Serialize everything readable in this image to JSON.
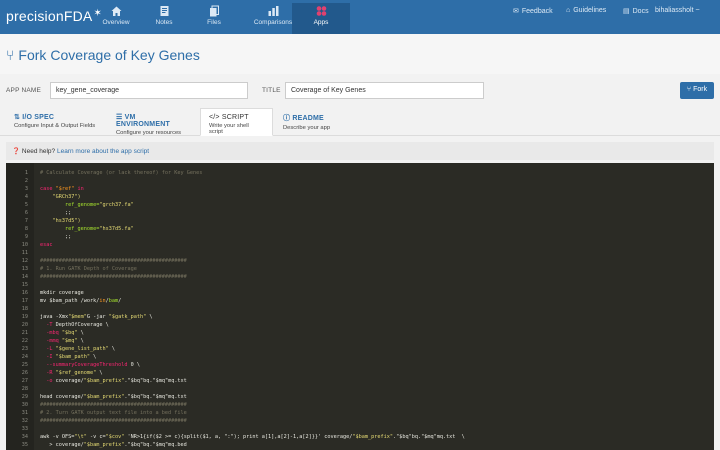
{
  "brand": "precisionFDA",
  "nav": [
    {
      "label": "Overview",
      "icon": "home-icon"
    },
    {
      "label": "Notes",
      "icon": "note-icon"
    },
    {
      "label": "Files",
      "icon": "files-icon"
    },
    {
      "label": "Comparisons",
      "icon": "chart-icon"
    },
    {
      "label": "Apps",
      "icon": "apps-icon"
    }
  ],
  "active_nav": "Apps",
  "right_links": {
    "feedback": "Feedback",
    "guidelines": "Guidelines",
    "docs": "Docs",
    "user": "bihaliassholt ~"
  },
  "page": {
    "title_prefix": "Fork",
    "title": "Coverage of Key Genes"
  },
  "form": {
    "app_name_label": "APP NAME",
    "app_name_value": "key_gene_coverage",
    "title_label": "TITLE",
    "title_value": "Coverage of Key Genes",
    "fork_button": "Fork"
  },
  "tabs": [
    {
      "label": "I/O SPEC",
      "sub": "Configure Input & Output Fields",
      "icon": "io-icon"
    },
    {
      "label": "VM ENVIRONMENT",
      "sub": "Configure your resources",
      "icon": "server-icon"
    },
    {
      "label": "SCRIPT",
      "sub": "Write your shell script",
      "icon": "code-icon"
    },
    {
      "label": "README",
      "sub": "Describe your app",
      "icon": "info-icon"
    }
  ],
  "active_tab": "SCRIPT",
  "help": {
    "prefix": "Need help?",
    "link": "Learn more about the app script"
  },
  "code_lines": [
    {
      "n": "1",
      "parts": [
        [
          "cm",
          "# Calculate Coverage (or lack thereof) for Key Genes"
        ]
      ]
    },
    {
      "n": "2",
      "parts": [
        [
          "",
          ""
        ]
      ]
    },
    {
      "n": "3",
      "parts": [
        [
          "kw",
          "case "
        ],
        [
          "vr",
          "\"$ref\""
        ],
        [
          "kw",
          " in"
        ]
      ]
    },
    {
      "n": "4",
      "parts": [
        [
          "st",
          "    \"GRCh37\")"
        ]
      ]
    },
    {
      "n": "5",
      "parts": [
        [
          "fn",
          "        ref_genome="
        ],
        [
          "st",
          "\"grch37.fa\""
        ]
      ]
    },
    {
      "n": "6",
      "parts": [
        [
          "",
          "        ;;"
        ]
      ]
    },
    {
      "n": "7",
      "parts": [
        [
          "st",
          "    \"hs37d5\")"
        ]
      ]
    },
    {
      "n": "8",
      "parts": [
        [
          "fn",
          "        ref_genome="
        ],
        [
          "st",
          "\"hs37d5.fa\""
        ]
      ]
    },
    {
      "n": "9",
      "parts": [
        [
          "",
          "        ;;"
        ]
      ]
    },
    {
      "n": "10",
      "parts": [
        [
          "kw",
          "esac"
        ]
      ]
    },
    {
      "n": "11",
      "parts": [
        [
          "",
          ""
        ]
      ]
    },
    {
      "n": "12",
      "parts": [
        [
          "cm",
          "###############################################"
        ]
      ]
    },
    {
      "n": "13",
      "parts": [
        [
          "cm",
          "# 1. Run GATK Depth of Coverage"
        ]
      ]
    },
    {
      "n": "14",
      "parts": [
        [
          "cm",
          "###############################################"
        ]
      ]
    },
    {
      "n": "15",
      "parts": [
        [
          "",
          ""
        ]
      ]
    },
    {
      "n": "16",
      "parts": [
        [
          "",
          "mkdir coverage"
        ]
      ]
    },
    {
      "n": "17",
      "parts": [
        [
          "",
          "mv $bam_path /work/"
        ],
        [
          "vr",
          "in"
        ],
        [
          "",
          "/"
        ],
        [
          "fn",
          "bam"
        ],
        [
          "",
          "/"
        ]
      ]
    },
    {
      "n": "18",
      "parts": [
        [
          "",
          ""
        ]
      ]
    },
    {
      "n": "19",
      "parts": [
        [
          "",
          "java -Xmx"
        ],
        [
          "st",
          "\"$mem\""
        ],
        [
          "",
          "G -jar "
        ],
        [
          "st",
          "\"$gatk_path\""
        ],
        [
          "",
          " \\"
        ]
      ]
    },
    {
      "n": "20",
      "parts": [
        [
          "kw",
          "  -T"
        ],
        [
          "",
          " DepthOfCoverage \\"
        ]
      ]
    },
    {
      "n": "21",
      "parts": [
        [
          "kw",
          "  -mbq"
        ],
        [
          "st",
          " \"$bq\""
        ],
        [
          "",
          " \\"
        ]
      ]
    },
    {
      "n": "22",
      "parts": [
        [
          "kw",
          "  -mmq"
        ],
        [
          "st",
          " \"$mq\""
        ],
        [
          "",
          " \\"
        ]
      ]
    },
    {
      "n": "23",
      "parts": [
        [
          "kw",
          "  -L"
        ],
        [
          "st",
          " \"$gene_list_path\""
        ],
        [
          "",
          " \\"
        ]
      ]
    },
    {
      "n": "24",
      "parts": [
        [
          "kw",
          "  -I"
        ],
        [
          "st",
          " \"$bam_path\""
        ],
        [
          "",
          " \\"
        ]
      ]
    },
    {
      "n": "25",
      "parts": [
        [
          "kw",
          "  --summaryCoverageThreshold"
        ],
        [
          "",
          " 0 \\"
        ]
      ]
    },
    {
      "n": "26",
      "parts": [
        [
          "kw",
          "  -R"
        ],
        [
          "st",
          " \"$ref_genome\""
        ],
        [
          "",
          " \\"
        ]
      ]
    },
    {
      "n": "27",
      "parts": [
        [
          "kw",
          "  -o"
        ],
        [
          "",
          " coverage/"
        ],
        [
          "st",
          "\"$bam_prefix\""
        ],
        [
          "",
          ".\"$bq\"bq.\"$mq\"mq.txt"
        ]
      ]
    },
    {
      "n": "28",
      "parts": [
        [
          "",
          ""
        ]
      ]
    },
    {
      "n": "29",
      "parts": [
        [
          "",
          "head coverage/"
        ],
        [
          "st",
          "\"$bam_prefix\""
        ],
        [
          "",
          ".\"$bq\"bq.\"$mq\"mq.txt"
        ]
      ]
    },
    {
      "n": "30",
      "parts": [
        [
          "cm",
          "###############################################"
        ]
      ]
    },
    {
      "n": "31",
      "parts": [
        [
          "cm",
          "# 2. Turn GATK output text file into a bed file"
        ]
      ]
    },
    {
      "n": "32",
      "parts": [
        [
          "cm",
          "###############################################"
        ]
      ]
    },
    {
      "n": "33",
      "parts": [
        [
          "",
          ""
        ]
      ]
    },
    {
      "n": "34",
      "parts": [
        [
          "",
          "awk -v OFS="
        ],
        [
          "st",
          "\"\\t\""
        ],
        [
          "",
          " -v c="
        ],
        [
          "st",
          "\"$cov\""
        ],
        [
          "",
          " 'NR>1{if($2 >= c){split($1, a, \":\"); print a[1],a[2]-1,a[2]}}' coverage/"
        ],
        [
          "st",
          "\"$bam_prefix\""
        ],
        [
          "",
          ".\"$bq\"bq.\"$mq\"mq.txt  \\"
        ]
      ]
    },
    {
      "n": "35",
      "parts": [
        [
          "",
          "   > coverage/"
        ],
        [
          "st",
          "\"$bam_prefix\""
        ],
        [
          "",
          ".\"$bq\"bq.\"$mq\"mq.bed"
        ]
      ]
    }
  ]
}
